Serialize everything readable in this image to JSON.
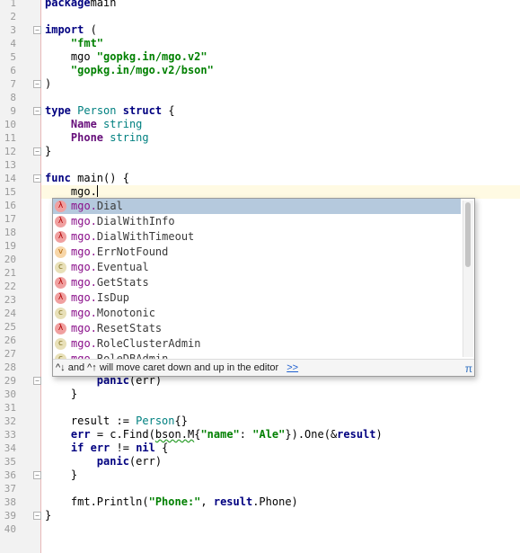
{
  "editor": {
    "line_numbers": [
      "1",
      "2",
      "3",
      "4",
      "5",
      "6",
      "7",
      "8",
      "9",
      "10",
      "11",
      "12",
      "13",
      "14",
      "15",
      "16",
      "17",
      "18",
      "19",
      "20",
      "21",
      "22",
      "23",
      "24",
      "25",
      "26",
      "27",
      "28",
      "29",
      "30",
      "31",
      "32",
      "33",
      "34",
      "35",
      "36",
      "37",
      "38",
      "39",
      "40"
    ],
    "lines": [
      [
        [
          "kw",
          "package"
        ],
        [
          "",
          "main"
        ]
      ],
      [],
      [
        [
          "kw",
          "import"
        ],
        [
          "",
          " ("
        ]
      ],
      [
        [
          "",
          ""
        ],
        [
          "",
          "    "
        ],
        [
          "str",
          "\"fmt\""
        ]
      ],
      [
        [
          "",
          "    mgo "
        ],
        [
          "str",
          "\"gopkg.in/mgo.v2\""
        ]
      ],
      [
        [
          "",
          "    "
        ],
        [
          "str",
          "\"gopkg.in/mgo.v2/bson\""
        ]
      ],
      [
        [
          "",
          ")"
        ]
      ],
      [],
      [
        [
          "kw",
          "type"
        ],
        [
          "",
          " "
        ],
        [
          "type",
          "Person"
        ],
        [
          "",
          " "
        ],
        [
          "kw",
          "struct"
        ],
        [
          "",
          " {"
        ]
      ],
      [
        [
          "",
          "    "
        ],
        [
          "field",
          "Name"
        ],
        [
          "",
          " "
        ],
        [
          "type",
          "string"
        ]
      ],
      [
        [
          "",
          "    "
        ],
        [
          "field",
          "Phone"
        ],
        [
          "",
          " "
        ],
        [
          "type",
          "string"
        ]
      ],
      [
        [
          "",
          "}"
        ]
      ],
      [],
      [
        [
          "kw",
          "func"
        ],
        [
          "",
          " main() {"
        ]
      ],
      [
        [
          "",
          "    mgo."
        ]
      ],
      [],
      [],
      [],
      [],
      [],
      [],
      [],
      [],
      [],
      [],
      [],
      [],
      [],
      [
        [
          "",
          "        "
        ],
        [
          "kw",
          "panic"
        ],
        [
          "",
          "(err)"
        ]
      ],
      [
        [
          "",
          "    }"
        ]
      ],
      [],
      [
        [
          "",
          "    result := "
        ],
        [
          "type",
          "Person"
        ],
        [
          "",
          "{}"
        ]
      ],
      [
        [
          "",
          "    "
        ],
        [
          "kw",
          "err"
        ],
        [
          "",
          " = c.Find("
        ],
        [
          "squig",
          "bson.M"
        ],
        [
          "",
          "{"
        ],
        [
          "str",
          "\"name\""
        ],
        [
          "",
          ": "
        ],
        [
          "str",
          "\"Ale\""
        ],
        [
          "",
          "}).One(&"
        ],
        [
          "kw",
          "result"
        ],
        [
          "",
          ")"
        ]
      ],
      [
        [
          "",
          "    "
        ],
        [
          "kw",
          "if"
        ],
        [
          "",
          " "
        ],
        [
          "kw",
          "err"
        ],
        [
          "",
          " != "
        ],
        [
          "kw",
          "nil"
        ],
        [
          "",
          " {"
        ]
      ],
      [
        [
          "",
          "        "
        ],
        [
          "kw",
          "panic"
        ],
        [
          "",
          "(err)"
        ]
      ],
      [
        [
          "",
          "    }"
        ]
      ],
      [],
      [
        [
          "",
          "    fmt.Println("
        ],
        [
          "str",
          "\"Phone:\""
        ],
        [
          "",
          ", "
        ],
        [
          "kw",
          "result"
        ],
        [
          "",
          ".Phone)"
        ]
      ],
      [
        [
          "",
          "}"
        ]
      ],
      []
    ]
  },
  "completion": {
    "items": [
      {
        "kind": "func",
        "badge": "λ",
        "pkg": "mgo.",
        "name": "Dial"
      },
      {
        "kind": "func",
        "badge": "λ",
        "pkg": "mgo.",
        "name": "DialWithInfo"
      },
      {
        "kind": "func",
        "badge": "λ",
        "pkg": "mgo.",
        "name": "DialWithTimeout"
      },
      {
        "kind": "var",
        "badge": "v",
        "pkg": "mgo.",
        "name": "ErrNotFound"
      },
      {
        "kind": "const",
        "badge": "c",
        "pkg": "mgo.",
        "name": "Eventual"
      },
      {
        "kind": "func",
        "badge": "λ",
        "pkg": "mgo.",
        "name": "GetStats"
      },
      {
        "kind": "func",
        "badge": "λ",
        "pkg": "mgo.",
        "name": "IsDup"
      },
      {
        "kind": "const",
        "badge": "c",
        "pkg": "mgo.",
        "name": "Monotonic"
      },
      {
        "kind": "func",
        "badge": "λ",
        "pkg": "mgo.",
        "name": "ResetStats"
      },
      {
        "kind": "const",
        "badge": "c",
        "pkg": "mgo.",
        "name": "RoleClusterAdmin"
      },
      {
        "kind": "const",
        "badge": "c",
        "pkg": "mgo.",
        "name": "RoleDBAdmin"
      }
    ],
    "selected_index": 0,
    "footer_hint": "^↓ and ^↑ will move caret down and up in the editor",
    "footer_link": ">>",
    "pi_symbol": "π"
  },
  "colors": {
    "keyword": "#000080",
    "string": "#008000",
    "selection": "#b5c9dd",
    "current_line": "#fffae3"
  }
}
